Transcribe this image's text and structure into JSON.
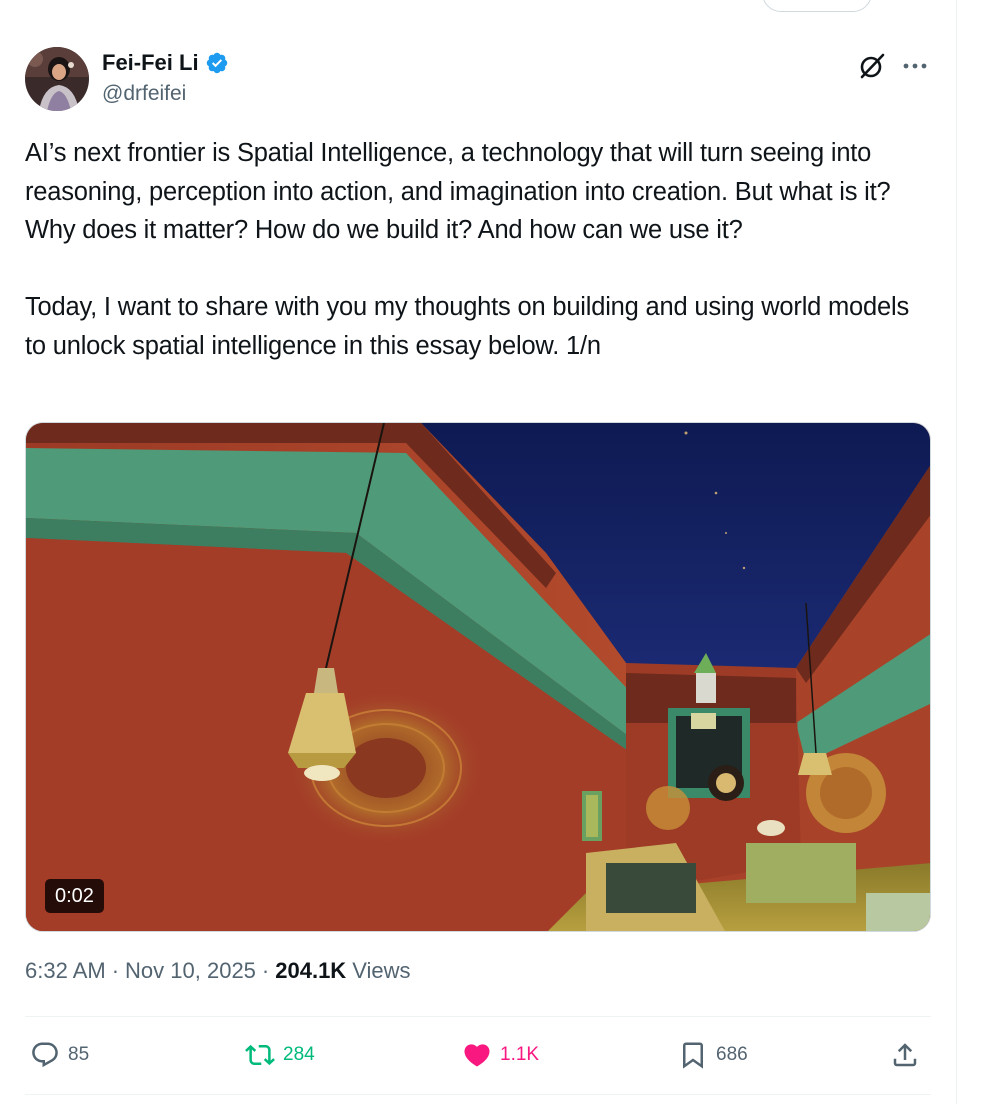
{
  "author": {
    "name": "Fei-Fei Li",
    "handle": "@drfeifei",
    "verified": true,
    "avatar_icon": "avatar-photo"
  },
  "tweet": {
    "paragraphs": [
      "AI’s next frontier is Spatial Intelligence, a technology that will turn seeing into reasoning, perception into action, and imagination into creation. But what is it? Why does it matter? How do we build it? And how can we use it?",
      "Today, I want to share with you my thoughts on building and using world models to unlock spatial intelligence in this essay below. 1/n"
    ]
  },
  "media": {
    "type": "video",
    "duration": "0:02"
  },
  "meta": {
    "time": "6:32 AM",
    "separator": "·",
    "date": "Nov 10, 2025",
    "views_count": "204.1K",
    "views_label": "Views"
  },
  "actions": {
    "replies": "85",
    "retweets": "284",
    "likes": "1.1K",
    "bookmarks": "686"
  },
  "colors": {
    "verified_blue": "#1d9bf0",
    "retweet_green": "#00ba7c",
    "like_pink": "#f91880",
    "secondary_text": "#536471"
  }
}
